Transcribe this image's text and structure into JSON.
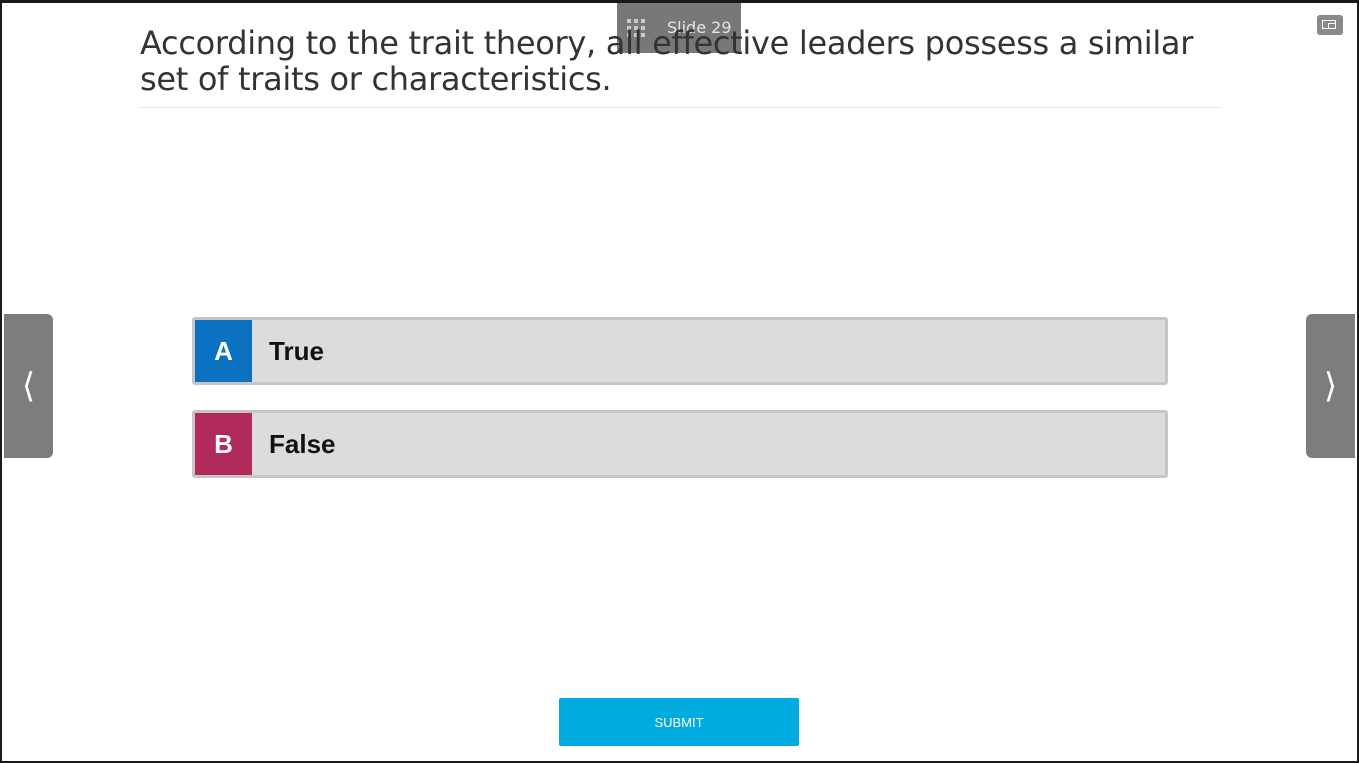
{
  "slide": {
    "label": "Slide 29",
    "grid_icon": "grid-icon"
  },
  "question": {
    "text": "According to the trait theory, all effective leaders possess a similar set of traits or characteristics."
  },
  "options": [
    {
      "letter": "A",
      "text": "True",
      "color": "#0a72c1"
    },
    {
      "letter": "B",
      "text": "False",
      "color": "#b02a5b"
    }
  ],
  "nav": {
    "prev": "⟨",
    "next": "⟩"
  },
  "submit": {
    "label": "SUBMIT",
    "color": "#00abe0"
  },
  "toolbar": {
    "window_icon": "restore-window-icon"
  }
}
